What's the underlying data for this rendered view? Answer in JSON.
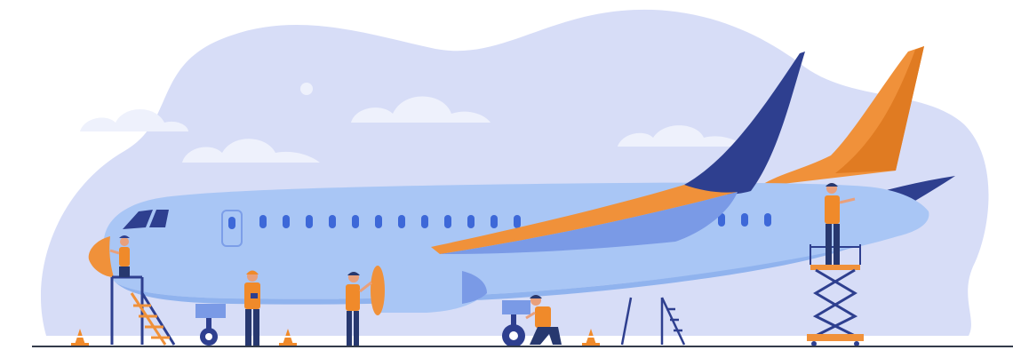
{
  "illustration": {
    "subject": "airplane-maintenance",
    "colors": {
      "background": "#ffffff",
      "sky_blob": "#d7ddf7",
      "cloud": "#eef1fc",
      "fuselage": "#a9c6f5",
      "fuselage_shade": "#90b3ee",
      "wing": "#7a9ae6",
      "navy": "#2e3f8f",
      "orange": "#f0913a",
      "window": "#3d68d8",
      "worker_vest": "#f08a2a",
      "worker_pants": "#27386f",
      "skin": "#e9a07c",
      "ground": "#333b4a",
      "cone": "#f08a2a"
    },
    "icons": [
      "cloud-icon",
      "sun-icon",
      "traffic-cone-icon",
      "ladder-icon",
      "scissor-lift-icon"
    ]
  }
}
